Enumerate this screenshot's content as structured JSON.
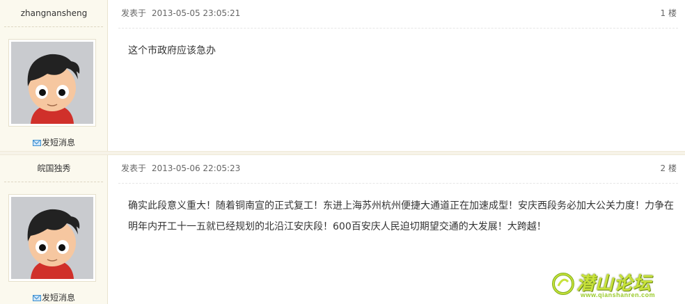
{
  "posts": [
    {
      "author": "zhangnansheng",
      "pm_label": "发短消息",
      "posted_prefix": "发表于",
      "posted_time": "2013-05-05 23:05:21",
      "floor": "1 楼",
      "content": "这个市政府应该急办"
    },
    {
      "author": "皖国独秀",
      "pm_label": "发短消息",
      "posted_prefix": "发表于",
      "posted_time": "2013-05-06 22:05:23",
      "floor": "2 楼",
      "content": "确实此段意义重大！随着铜南宣的正式复工！东进上海苏州杭州便捷大通道正在加速成型！安庆西段务必加大公关力度！力争在明年内开工十一五就已经规划的北沿江安庆段！600百安庆人民迫切期望交通的大发展！大跨越！"
    }
  ],
  "watermark": {
    "title": "潜山论坛",
    "url": "www.qianshanren.com",
    "icon": "forum-logo-icon"
  },
  "colors": {
    "author_bg": "#fbf9ee",
    "logo_green": "#c8e23a",
    "mail_blue": "#3a8ed0"
  }
}
